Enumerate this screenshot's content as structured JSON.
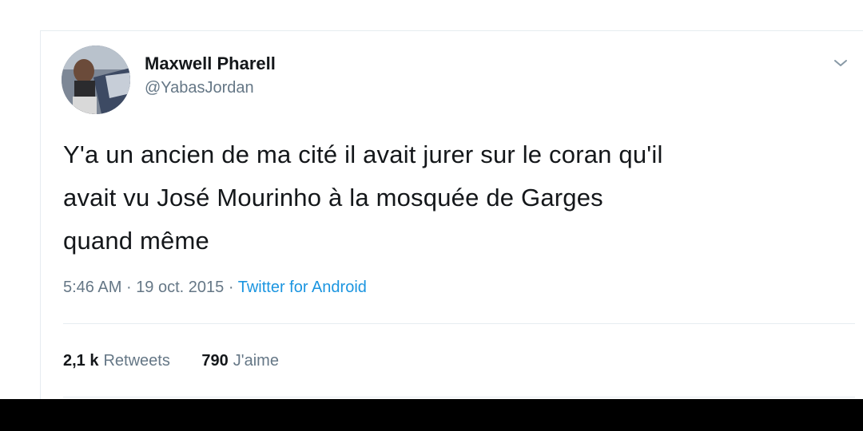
{
  "tweet": {
    "author": {
      "display_name": "Maxwell Pharell",
      "handle": "@YabasJordan"
    },
    "text_lines": [
      "Y'a un ancien de ma cité il avait jurer sur le coran qu'il",
      "avait vu José Mourinho à la mosquée de Garges",
      "quand même"
    ],
    "time": "5:46 AM",
    "separator": "·",
    "date": "19 oct. 2015",
    "source": "Twitter for Android",
    "stats": {
      "retweets_count": "2,1 k",
      "retweets_label": "Retweets",
      "likes_count": "790",
      "likes_label": "J'aime"
    }
  },
  "icons": {
    "menu": "chevron-down-icon",
    "avatar": "user-avatar"
  },
  "colors": {
    "text_primary": "#14171a",
    "text_secondary": "#657786",
    "link": "#1b95e0",
    "divider": "#e6ecf0"
  }
}
